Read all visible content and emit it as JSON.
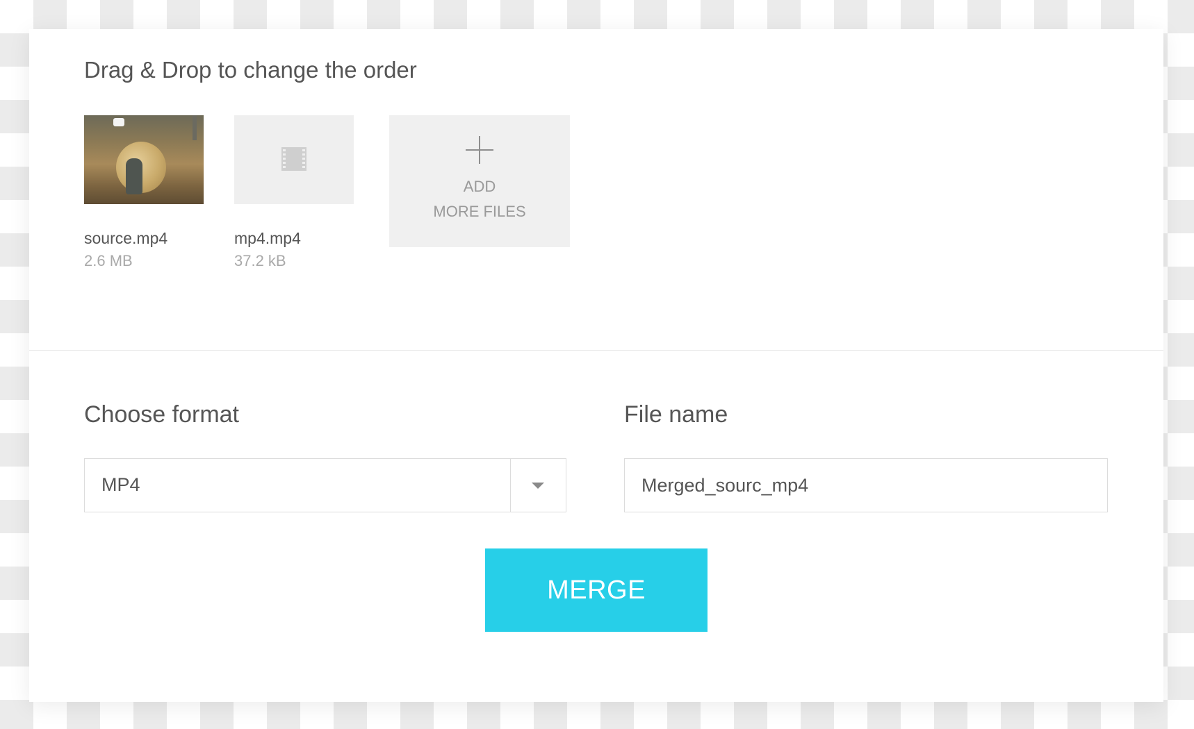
{
  "reorder_section": {
    "title": "Drag & Drop to change the order",
    "files": [
      {
        "name": "source.mp4",
        "size": "2.6 MB",
        "thumbnail": "video-frame-image"
      },
      {
        "name": "mp4.mp4",
        "size": "37.2 kB",
        "thumbnail": "film-icon"
      }
    ],
    "add_more": {
      "line1": "ADD",
      "line2": "MORE FILES",
      "icon": "plus-icon"
    }
  },
  "format": {
    "label": "Choose format",
    "selected": "MP4",
    "icon": "chevron-down-icon"
  },
  "filename": {
    "label": "File name",
    "value": "Merged_sourc_mp4"
  },
  "merge_button": {
    "label": "MERGE",
    "color": "#27cfe8"
  }
}
